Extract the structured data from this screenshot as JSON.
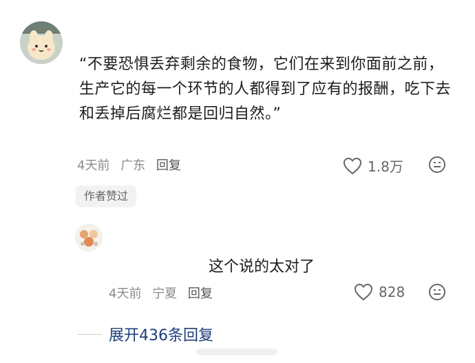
{
  "comment": {
    "text": "“不要恐惧丢弃剩余的食物，它们在来到你面前之前，生产它的每一个环节的人都得到了应有的报酬，吃下去和丢掉后腐烂都是回归自然。”",
    "time": "4天前",
    "location": "广东",
    "reply_label": "回复",
    "likes": "1.8万",
    "author_badge": "作者赞过"
  },
  "reply": {
    "text": "这个说的太对了",
    "time": "4天前",
    "location": "宁夏",
    "reply_label": "回复",
    "likes": "828"
  },
  "expand": {
    "label": "展开436条回复"
  },
  "icons": {
    "like": "heart-outline-icon",
    "emoji": "emoji-face-icon"
  }
}
